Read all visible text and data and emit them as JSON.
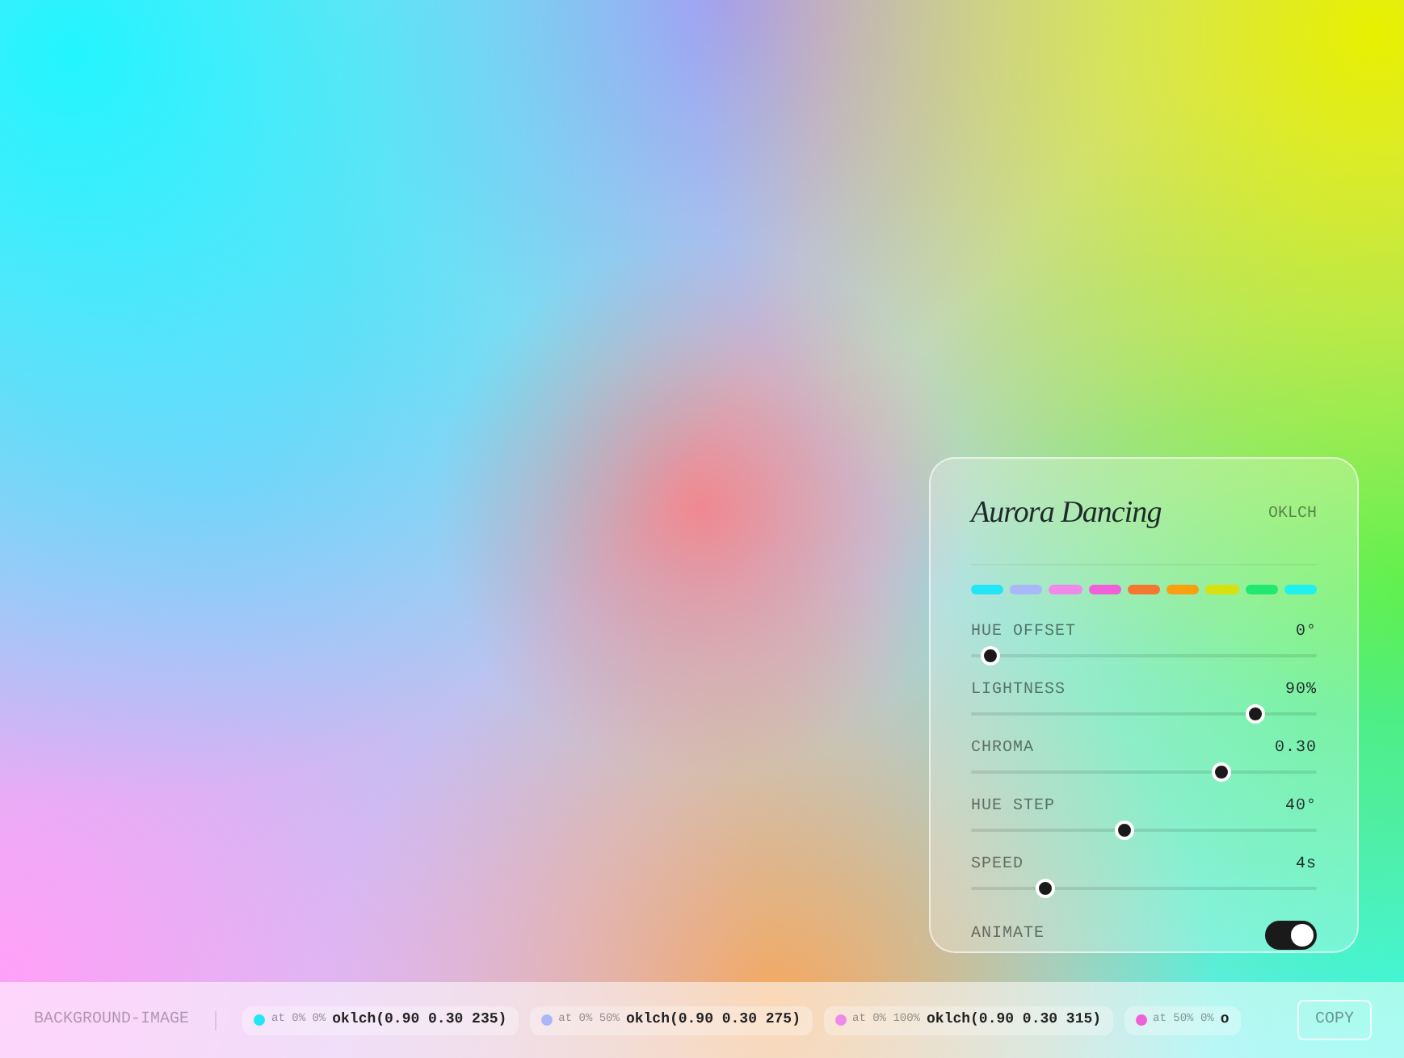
{
  "panel": {
    "title": "Aurora Dancing",
    "mode": "OKLCH",
    "swatches": [
      {
        "color": "#22e5f5"
      },
      {
        "color": "#a8b8f8"
      },
      {
        "color": "#f08ae8"
      },
      {
        "color": "#f060d8"
      },
      {
        "color": "#f47830"
      },
      {
        "color": "#f8a010"
      },
      {
        "color": "#d8e010"
      },
      {
        "color": "#20e870"
      },
      {
        "color": "#20f0f0"
      }
    ],
    "controls": [
      {
        "kind": "slider",
        "label": "HUE OFFSET",
        "reading": "0°",
        "level": 0.03
      },
      {
        "kind": "slider",
        "label": "LIGHTNESS",
        "reading": "90%",
        "level": 0.84
      },
      {
        "kind": "slider",
        "label": "CHROMA",
        "reading": "0.30",
        "level": 0.74
      },
      {
        "kind": "slider",
        "label": "HUE STEP",
        "reading": "40°",
        "level": 0.44
      },
      {
        "kind": "slider",
        "label": "SPEED",
        "reading": "4s",
        "level": 0.2
      },
      {
        "kind": "toggle",
        "label": "ANIMATE",
        "on": true
      }
    ]
  },
  "bottom_bar": {
    "label": "BACKGROUND-IMAGE",
    "stops": [
      {
        "color": "#22e5f5",
        "position": "at 0% 0%",
        "value": "oklch(0.90 0.30 235)"
      },
      {
        "color": "#a8b8f8",
        "position": "at 0% 50%",
        "value": "oklch(0.90 0.30 275)"
      },
      {
        "color": "#f08ae8",
        "position": "at 0% 100%",
        "value": "oklch(0.90 0.30 315)"
      },
      {
        "color": "#f060d8",
        "position": "at 50% 0%",
        "value": "o"
      }
    ],
    "copy_button": "COPY"
  }
}
